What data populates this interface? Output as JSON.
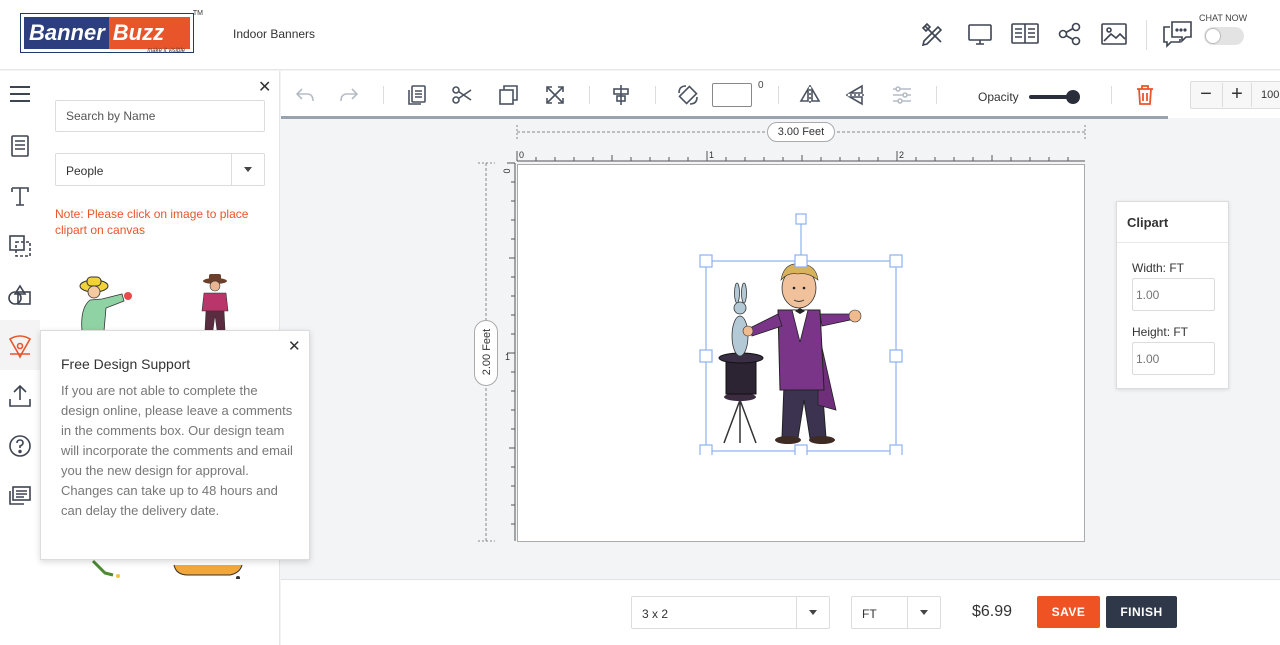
{
  "brand": {
    "part1": "Banner",
    "part2": "Buzz",
    "tagline": "make it visible",
    "tm": "TM"
  },
  "header": {
    "page_title": "Indoor Banners",
    "chat_label": "CHAT NOW",
    "chat_toggle_on": false
  },
  "panel": {
    "search_placeholder": "Search by Name",
    "category": "People",
    "note": "Note: Please click on image to place clipart on canvas"
  },
  "support": {
    "title": "Free Design Support",
    "body": "If you are not able to complete the design online, please leave a comments in the comments box. Our design team will incorporate the comments and email you the new design for approval. Changes can take up to 48 hours and can delay the delivery date."
  },
  "toolbar": {
    "rotate_value": "",
    "degree_symbol": "0",
    "opacity_label": "Opacity",
    "opacity_value": 1.0,
    "zoom_value": "100"
  },
  "canvas": {
    "width_label": "3.00 Feet",
    "height_label": "2.00 Feet",
    "x_ticks": [
      "0",
      "1",
      "2"
    ],
    "y_ticks": [
      "0",
      "1"
    ]
  },
  "clipart_panel": {
    "title": "Clipart",
    "width_label": "Width: FT",
    "width_placeholder": "1.00",
    "height_label": "Height: FT",
    "height_placeholder": "1.00"
  },
  "bottom": {
    "size": "3 x 2",
    "unit": "FT",
    "price": "$6.99",
    "save_label": "SAVE",
    "finish_label": "FINISH"
  },
  "colors": {
    "accent": "#f05323",
    "dark": "#2e3848",
    "brand_blue": "#2c3e7d",
    "note": "#e8552b"
  }
}
